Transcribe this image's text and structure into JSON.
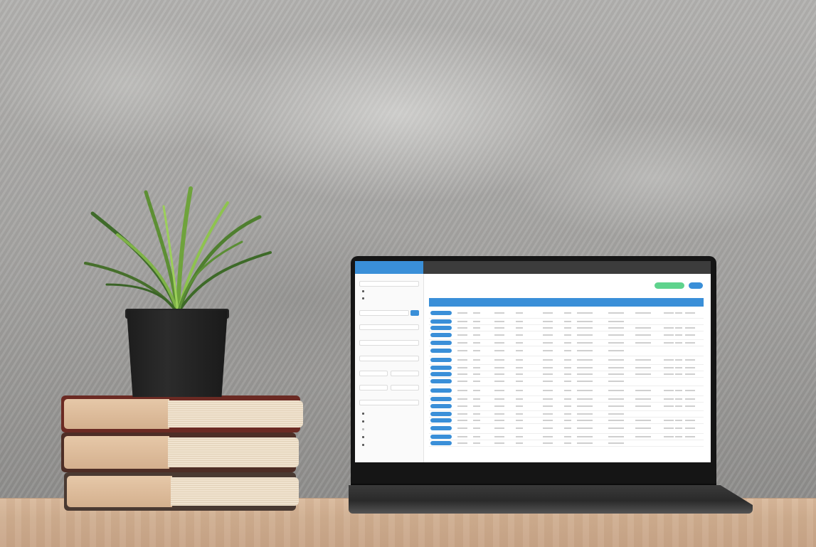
{
  "scene": {
    "objects": [
      "concrete-wall",
      "wooden-desk",
      "stacked-books",
      "potted-plant",
      "laptop"
    ]
  },
  "screen_app": {
    "colors": {
      "accent": "#3a8fd8",
      "success": "#5fd38d",
      "topbar": "#3c3c3c"
    },
    "sidebar_check_count": 2,
    "sidebar_bottom_check_count": 5,
    "table_row_count": 18,
    "table_column_count": 13
  }
}
